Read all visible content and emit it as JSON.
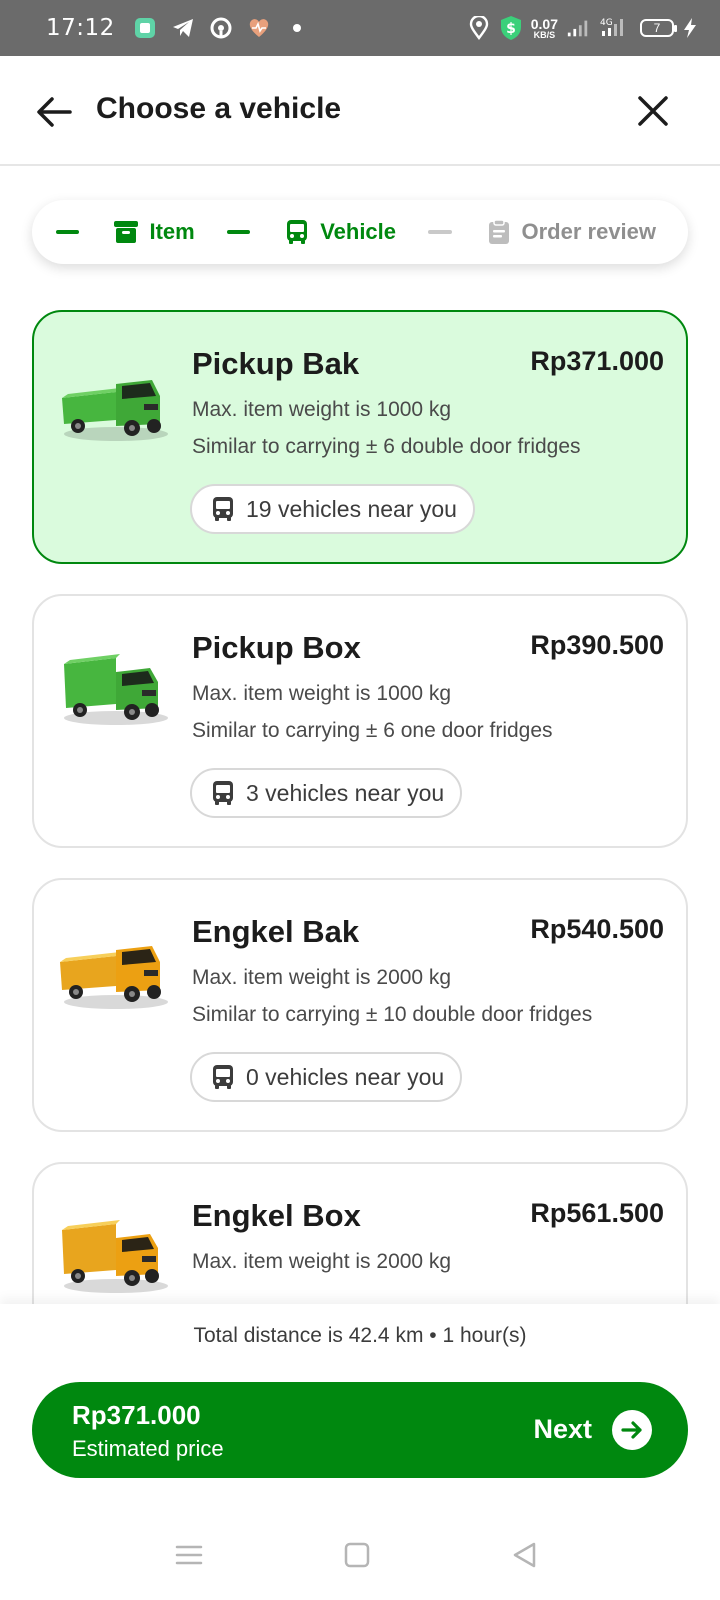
{
  "status_bar": {
    "time": "17:12",
    "network_speed_value": "0.07",
    "network_speed_unit": "KB/S",
    "network_type": "4G",
    "battery_level": "7"
  },
  "header": {
    "title": "Choose a vehicle"
  },
  "stepper": {
    "steps": [
      {
        "label": "Item",
        "state": "done",
        "icon": "box-icon"
      },
      {
        "label": "Vehicle",
        "state": "active",
        "icon": "bus-icon"
      },
      {
        "label": "Order review",
        "state": "inactive",
        "icon": "clipboard-icon"
      }
    ]
  },
  "vehicles": [
    {
      "name": "Pickup Bak",
      "price": "Rp371.000",
      "max_weight": "Max. item weight is 1000 kg",
      "similar": "Similar to carrying ± 6 double door fridges",
      "nearby": "19 vehicles near you",
      "selected": true,
      "color": "#3fae3a"
    },
    {
      "name": "Pickup Box",
      "price": "Rp390.500",
      "max_weight": "Max. item weight is 1000 kg",
      "similar": "Similar to carrying ± 6 one door fridges",
      "nearby": "3 vehicles near you",
      "selected": false,
      "color": "#3fae3a"
    },
    {
      "name": "Engkel Bak",
      "price": "Rp540.500",
      "max_weight": "Max. item weight is 2000 kg",
      "similar": "Similar to carrying ± 10 double door fridges",
      "nearby": "0 vehicles near you",
      "selected": false,
      "color": "#f2a91f"
    },
    {
      "name": "Engkel Box",
      "price": "Rp561.500",
      "max_weight": "Max. item weight is 2000 kg",
      "similar": "",
      "nearby": "",
      "selected": false,
      "color": "#f2a91f"
    }
  ],
  "footer": {
    "distance": "Total distance is 42.4 km • 1 hour(s)",
    "estimated_price": "Rp371.000",
    "estimated_label": "Estimated price",
    "next_label": "Next"
  },
  "colors": {
    "primary": "#00880f",
    "selected_bg": "#dafbdd"
  }
}
